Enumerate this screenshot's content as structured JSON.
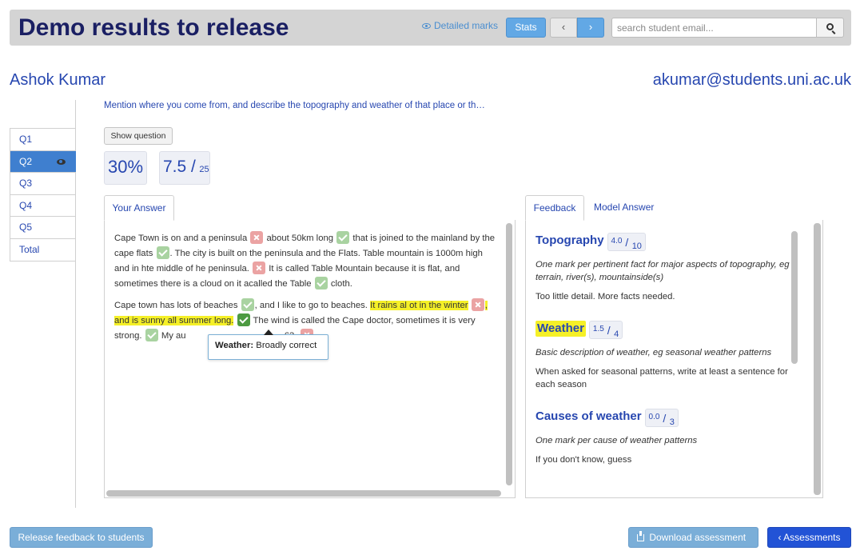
{
  "header": {
    "title": "Demo results to release",
    "detailed_marks_label": "Detailed marks",
    "stats_label": "Stats",
    "prev_label": "‹",
    "next_label": "›",
    "search_placeholder": "search student email..."
  },
  "student": {
    "name": "Ashok Kumar",
    "email": "akumar@students.uni.ac.uk"
  },
  "question_nav": [
    {
      "label": "Q1",
      "active": false
    },
    {
      "label": "Q2",
      "active": true
    },
    {
      "label": "Q3",
      "active": false
    },
    {
      "label": "Q4",
      "active": false
    },
    {
      "label": "Q5",
      "active": false
    },
    {
      "label": "Total",
      "active": false
    }
  ],
  "question": {
    "text": "Mention where you come from, and describe the topography and weather of that place or th…",
    "show_question_label": "Show question",
    "percent": "30%",
    "score": "7.5",
    "score_max": "25"
  },
  "answer": {
    "tab_label": "Your Answer",
    "p1": {
      "s1": "Cape Town is on and a peninsula",
      "s2": "about 50km long",
      "s3": "that is joined to the mainland by the cape flats",
      "s4": ". The city is built on the peninsula and the Flats. Table mountain is 1000m high and in hte middle of he peninsula.",
      "s5": "It is called Table Mountain because it is flat, and sometimes there is a cloud on it acalled the Table",
      "s6": "cloth."
    },
    "p2": {
      "s1": "Cape town has lots of beaches",
      "s2": ", and I like to go to beaches.",
      "s3_hl": "It rains al ot in the winter",
      "s4_hl": ", and is sunny all summer long.",
      "s5": "The wind is called the Cape doctor, sometimes it is very strong.",
      "s6": "My au",
      "s7": "63."
    },
    "tooltip": {
      "label": "Weather:",
      "text": "Broadly correct"
    }
  },
  "feedback": {
    "tab_label": "Feedback",
    "model_tab_label": "Model Answer",
    "criteria": [
      {
        "title": "Topography",
        "score": "4.0",
        "max": "10",
        "description": "One mark per pertinent fact for major aspects of topography, eg terrain, river(s), mountainside(s)",
        "comment": "Too little detail. More facts needed."
      },
      {
        "title": "Weather",
        "score": "1.5",
        "max": "4",
        "description": "Basic description of weather, eg seasonal weather patterns",
        "comment": "When asked for seasonal patterns, write at least a sentence for each season"
      },
      {
        "title": "Causes of weather",
        "score": "0.0",
        "max": "3",
        "description": "One mark per cause of weather patterns",
        "comment": "If you don't know, guess"
      }
    ]
  },
  "footer": {
    "release_label": "Release feedback to students",
    "download_label": "Download assessment",
    "assessments_label": "‹ Assessments"
  },
  "colors": {
    "accent": "#2747b0",
    "highlight": "#f5f027",
    "active_nav": "#3f7fcf",
    "tick": "#a9d3a1",
    "cross": "#eba3a3"
  }
}
